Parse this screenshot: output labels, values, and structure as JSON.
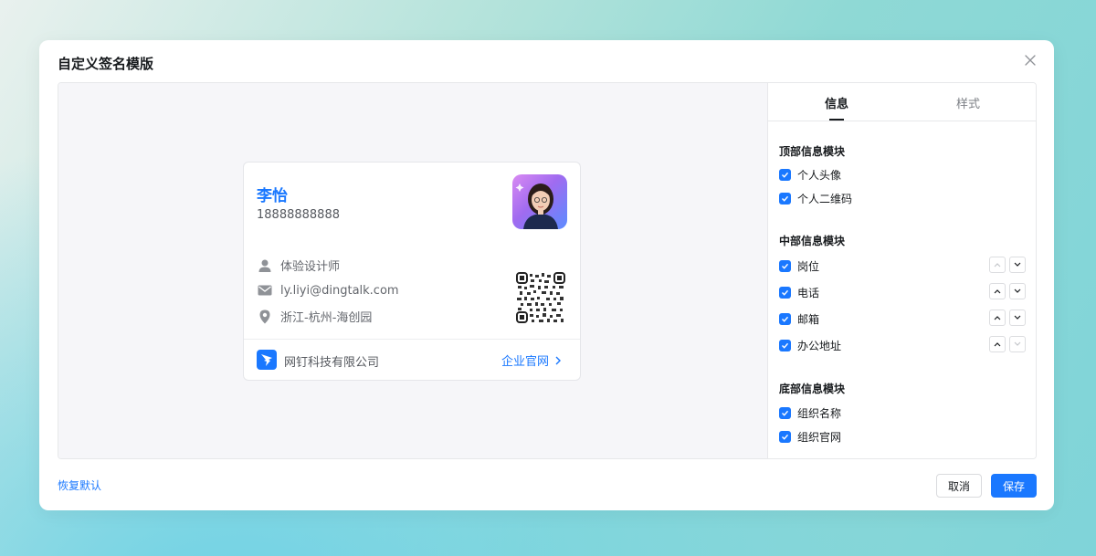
{
  "dialog": {
    "title": "自定义签名模版"
  },
  "card": {
    "name": "李怡",
    "phone": "18888888888",
    "position": "体验设计师",
    "email": "ly.liyi@dingtalk.com",
    "address": "浙江-杭州-海创园",
    "org_name": "网钉科技有限公司",
    "website_label": "企业官网"
  },
  "panel": {
    "tabs": [
      {
        "label": "信息",
        "active": true
      },
      {
        "label": "样式",
        "active": false
      }
    ],
    "top_section": {
      "title": "顶部信息模块",
      "options": [
        {
          "label": "个人头像",
          "checked": true
        },
        {
          "label": "个人二维码",
          "checked": true
        }
      ]
    },
    "middle_section": {
      "title": "中部信息模块",
      "options": [
        {
          "label": "岗位",
          "checked": true
        },
        {
          "label": "电话",
          "checked": true
        },
        {
          "label": "邮箱",
          "checked": true
        },
        {
          "label": "办公地址",
          "checked": true
        }
      ]
    },
    "bottom_section": {
      "title": "底部信息模块",
      "options": [
        {
          "label": "组织名称",
          "checked": true
        },
        {
          "label": "组织官网",
          "checked": true
        }
      ]
    }
  },
  "footer": {
    "restore_label": "恢复默认",
    "cancel_label": "取消",
    "save_label": "保存"
  },
  "colors": {
    "accent": "#1a78ff",
    "text": "#171a1d"
  }
}
